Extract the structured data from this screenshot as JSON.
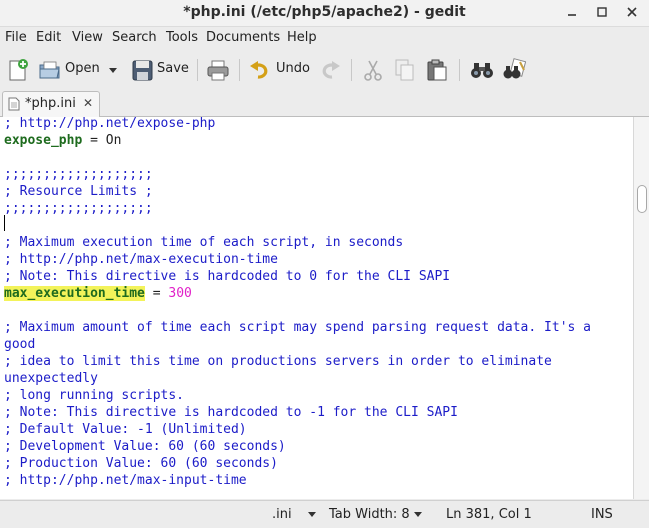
{
  "window": {
    "title": "*php.ini (/etc/php5/apache2) - gedit"
  },
  "menu": [
    "File",
    "Edit",
    "View",
    "Search",
    "Tools",
    "Documents",
    "Help"
  ],
  "toolbar": {
    "open_label": "Open",
    "save_label": "Save",
    "undo_label": "Undo"
  },
  "tab": {
    "label": "*php.ini",
    "close": "✕"
  },
  "editor": {
    "lines": [
      {
        "parts": [
          {
            "t": "; http://php.net/expose-php",
            "c": "comment"
          }
        ]
      },
      {
        "parts": [
          {
            "t": "expose_php",
            "c": "key"
          },
          {
            "t": " = On",
            "c": "plain"
          }
        ]
      },
      {
        "parts": [
          {
            "t": "",
            "c": "plain"
          }
        ]
      },
      {
        "parts": [
          {
            "t": ";;;;;;;;;;;;;;;;;;;",
            "c": "comment"
          }
        ]
      },
      {
        "parts": [
          {
            "t": "; Resource Limits ;",
            "c": "comment"
          }
        ]
      },
      {
        "parts": [
          {
            "t": ";;;;;;;;;;;;;;;;;;;",
            "c": "comment"
          }
        ]
      },
      {
        "parts": [
          {
            "t": "",
            "c": "plain"
          }
        ]
      },
      {
        "parts": [
          {
            "t": "; Maximum execution time of each script, in seconds",
            "c": "comment"
          }
        ]
      },
      {
        "parts": [
          {
            "t": "; http://php.net/max-execution-time",
            "c": "comment"
          }
        ]
      },
      {
        "parts": [
          {
            "t": "; Note: This directive is hardcoded to 0 for the CLI SAPI",
            "c": "comment"
          }
        ]
      },
      {
        "parts": [
          {
            "t": "max_execution_time",
            "c": "key-hl"
          },
          {
            "t": " = ",
            "c": "plain"
          },
          {
            "t": "300",
            "c": "num"
          }
        ]
      },
      {
        "parts": [
          {
            "t": "",
            "c": "plain"
          }
        ]
      },
      {
        "parts": [
          {
            "t": "; Maximum amount of time each script may spend parsing request data. It's a",
            "c": "comment"
          }
        ]
      },
      {
        "parts": [
          {
            "t": "good",
            "c": "comment"
          }
        ]
      },
      {
        "parts": [
          {
            "t": "; idea to limit this time on productions servers in order to eliminate",
            "c": "comment"
          }
        ]
      },
      {
        "parts": [
          {
            "t": "unexpectedly",
            "c": "comment"
          }
        ]
      },
      {
        "parts": [
          {
            "t": "; long running scripts.",
            "c": "comment"
          }
        ]
      },
      {
        "parts": [
          {
            "t": "; Note: This directive is hardcoded to -1 for the CLI SAPI",
            "c": "comment"
          }
        ]
      },
      {
        "parts": [
          {
            "t": "; Default Value: -1 (Unlimited)",
            "c": "comment"
          }
        ]
      },
      {
        "parts": [
          {
            "t": "; Development Value: 60 (60 seconds)",
            "c": "comment"
          }
        ]
      },
      {
        "parts": [
          {
            "t": "; Production Value: 60 (60 seconds)",
            "c": "comment"
          }
        ]
      },
      {
        "parts": [
          {
            "t": "; http://php.net/max-input-time",
            "c": "comment"
          }
        ]
      }
    ]
  },
  "status": {
    "language": ".ini",
    "tab_width": "Tab Width:  8",
    "position": "Ln 381, Col 1",
    "mode": "INS"
  },
  "colors": {
    "comment": "#1c1cc8",
    "keyword": "#1e6b1e",
    "number": "#e020c8",
    "highlight": "#f3f35a"
  }
}
